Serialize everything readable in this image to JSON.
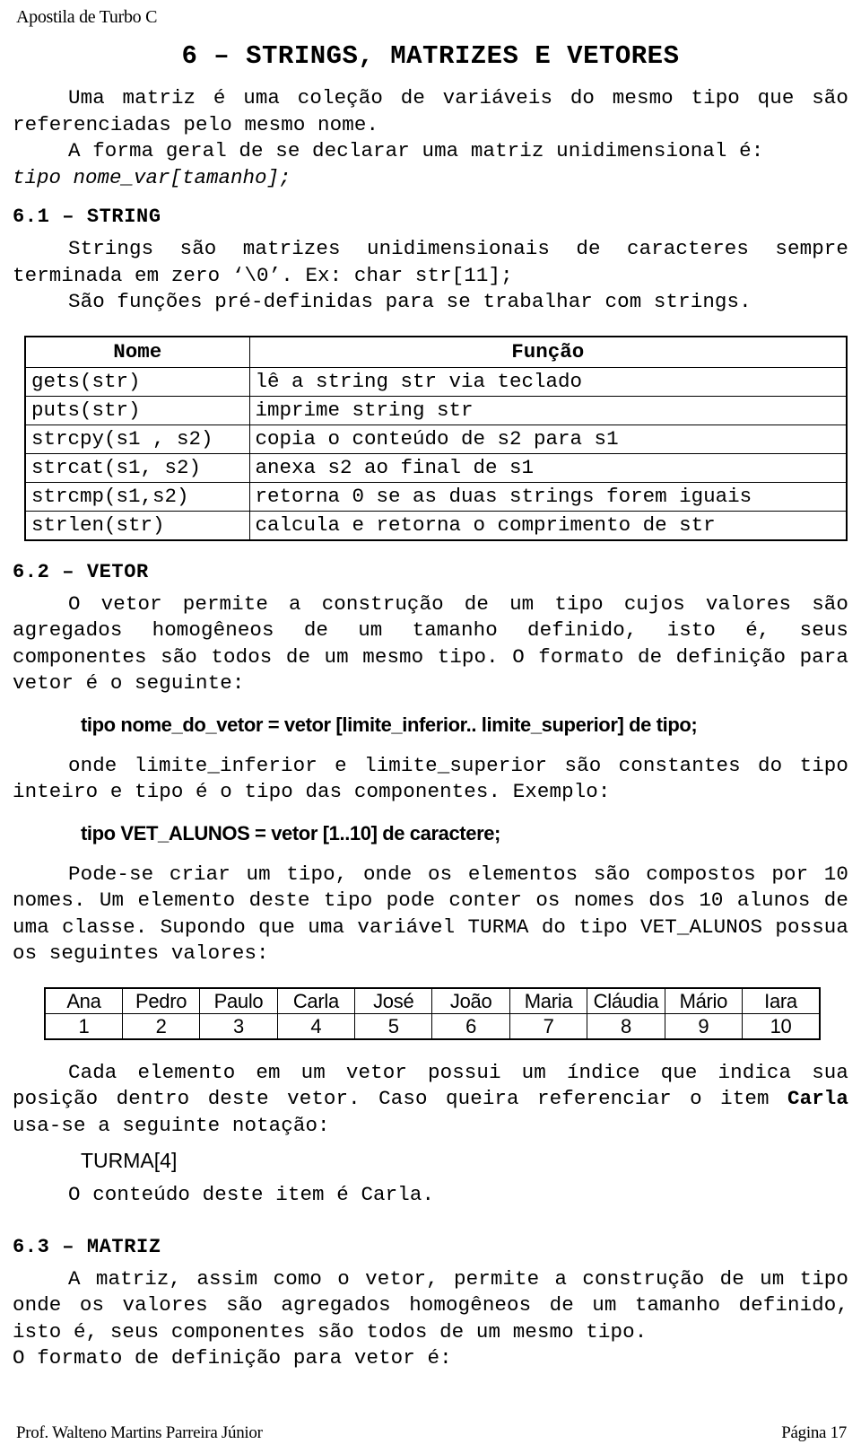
{
  "header": {
    "title": "Apostila de Turbo C"
  },
  "chapter": {
    "title": "6 – STRINGS, MATRIZES E VETORES"
  },
  "intro": {
    "p1": "Uma matriz é uma coleção de variáveis do mesmo tipo que são referenciadas pelo mesmo nome.",
    "p2": "A forma geral de se declarar uma matriz unidimensional é:",
    "declaration": "tipo  nome_var[tamanho];"
  },
  "section_string": {
    "heading": "6.1 – STRING",
    "p1": "Strings são matrizes unidimensionais de caracteres sempre terminada em zero ‘\\0’. Ex: char str[11];",
    "p2": "São funções pré-definidas para se trabalhar com strings.",
    "table": {
      "columns": [
        "Nome",
        "Função"
      ],
      "rows": [
        [
          "gets(str)",
          "lê a string str via teclado"
        ],
        [
          "puts(str)",
          "imprime string str"
        ],
        [
          "strcpy(s1 , s2)",
          "copia o conteúdo de s2 para s1"
        ],
        [
          "strcat(s1, s2)",
          "anexa s2  ao final de s1"
        ],
        [
          "strcmp(s1,s2)",
          "retorna 0 se as duas strings forem iguais"
        ],
        [
          "strlen(str)",
          "calcula e retorna o comprimento de str"
        ]
      ]
    }
  },
  "section_vetor": {
    "heading": "6.2 – VETOR",
    "p1": "O vetor permite a construção de um tipo cujos valores são agregados homogêneos de um tamanho definido, isto é, seus componentes são todos de um mesmo tipo. O formato de definição para vetor é o seguinte:",
    "syntax": "tipo nome_do_vetor = vetor [limite_inferior.. limite_superior] de tipo;",
    "p2": "onde limite_inferior e limite_superior são constantes do tipo inteiro e tipo é o tipo das componentes. Exemplo:",
    "example": "tipo VET_ALUNOS = vetor [1..10] de caractere;",
    "p3_a": "Pode-se criar um tipo, onde os elementos são compostos por 10 nomes. Um elemento deste tipo pode conter os nomes dos 10 alunos de uma classe. Supondo que uma variável TURMA do tipo VET_ALUNOS possua os seguintes valores:",
    "turma_table": {
      "names": [
        "Ana",
        "Pedro",
        "Paulo",
        "Carla",
        "José",
        "João",
        "Maria",
        "Cláudia",
        "Mário",
        "Iara"
      ],
      "indices": [
        "1",
        "2",
        "3",
        "4",
        "5",
        "6",
        "7",
        "8",
        "9",
        "10"
      ]
    },
    "p4_pre": "Cada elemento em um vetor possui um índice que indica sua posição dentro deste vetor. Caso queira referenciar o item ",
    "p4_bold": "Carla",
    "p4_post": " usa-se a seguinte notação:",
    "notation": "TURMA[4]",
    "p5": "O conteúdo deste item é Carla."
  },
  "section_matriz": {
    "heading": "6.3 – MATRIZ",
    "p1": "A matriz, assim como o vetor, permite a construção de um tipo onde os valores são agregados homogêneos de um tamanho definido, isto é, seus componentes são todos de um mesmo tipo.",
    "p2": "O formato de definição para vetor é:"
  },
  "footer": {
    "author": "Prof. Walteno Martins Parreira Júnior",
    "page": "Página 17"
  }
}
